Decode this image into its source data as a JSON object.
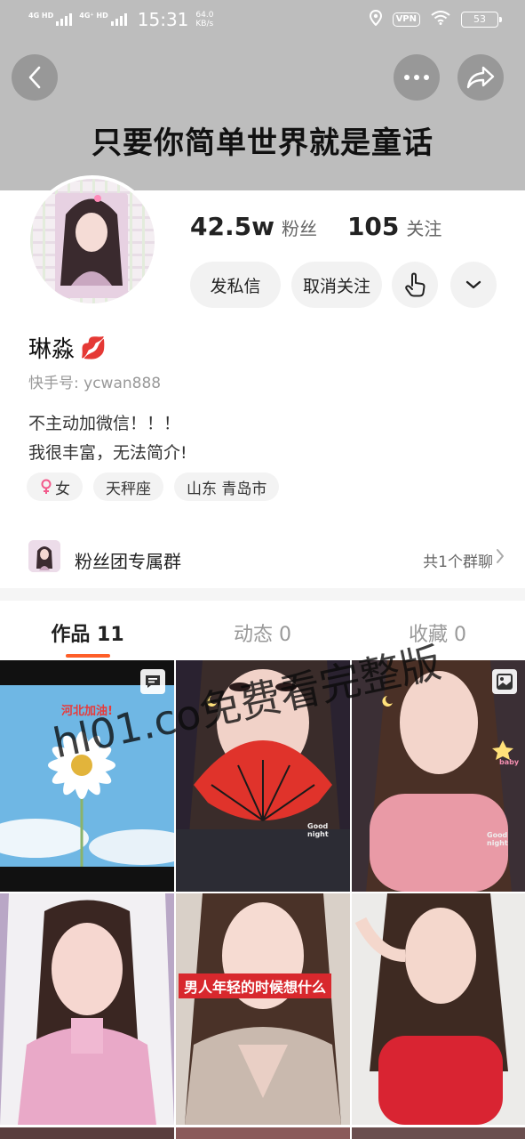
{
  "status_bar": {
    "net1": "4G HD",
    "net2": "4G⁺ HD",
    "time": "15:31",
    "speed_value": "64.0",
    "speed_unit": "KB/s",
    "vpn": "VPN",
    "battery": "53",
    "icons": [
      "location-icon",
      "wifi-icon",
      "battery-icon"
    ]
  },
  "header": {
    "back_icon": "back-arrow-icon",
    "more_icon": "more-dots-icon",
    "share_icon": "share-icon",
    "banner_text": "只要你简单世界就是童话"
  },
  "profile": {
    "followers_count": "42.5w",
    "followers_label": "粉丝",
    "following_count": "105",
    "following_label": "关注",
    "message_button": "发私信",
    "unfollow_button": "取消关注",
    "nickname": "琳淼",
    "nickname_emoji": "💋",
    "account_id": "快手号: ycwan888",
    "bio_line1": "不主动加微信！！！",
    "bio_line2": "我很丰富，无法简介!",
    "tags": [
      {
        "icon": "female-icon",
        "label": "女"
      },
      {
        "label": "天秤座"
      },
      {
        "label": "山东 青岛市"
      }
    ]
  },
  "fan_group": {
    "title": "粉丝团专属群",
    "count": "共1个群聊"
  },
  "tabs": [
    {
      "label": "作品",
      "count": "11",
      "active": true
    },
    {
      "label": "动态",
      "count": "0",
      "active": false
    },
    {
      "label": "收藏",
      "count": "0",
      "active": false
    }
  ],
  "grid": {
    "cell1_caption": "河北加油!",
    "cell5_caption": "男人年轻的时候想什么",
    "small_text_1": "Good night",
    "small_text_2": "Good night",
    "small_text_3": "baby"
  },
  "watermark": "hl01.co免费看完整版",
  "colors": {
    "accent": "#fe5e28",
    "header_bg": "#bdbdbd"
  }
}
